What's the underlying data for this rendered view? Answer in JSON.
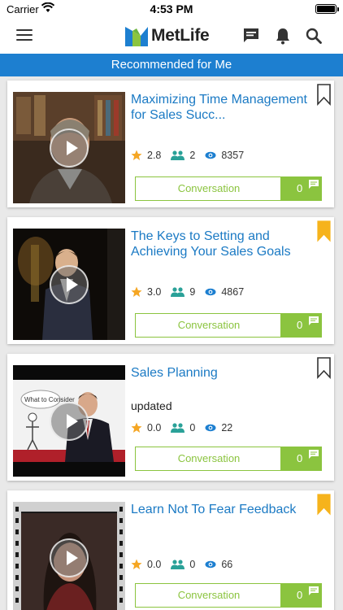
{
  "status_bar": {
    "carrier": "Carrier",
    "time": "4:53 PM"
  },
  "header": {
    "brand": "MetLife",
    "brand_color": "#1d7fd0"
  },
  "section": {
    "title": "Recommended for Me"
  },
  "colors": {
    "title_blue": "#1b7ac4",
    "accent_green": "#8bc43f",
    "bookmark_gold": "#f6b31c",
    "star": "#f5a623",
    "people": "#2aa198"
  },
  "cards": [
    {
      "title": "Maximizing Time Management for Sales Succ...",
      "subtitle": "",
      "rating": "2.8",
      "participants": "2",
      "views": "8357",
      "conversation_label": "Conversation",
      "conversation_count": "0",
      "bookmarked": false,
      "thumbnail": "man-in-library"
    },
    {
      "title": "The Keys to Setting and Achieving Your Sales Goals",
      "subtitle": "",
      "rating": "3.0",
      "participants": "9",
      "views": "4867",
      "conversation_label": "Conversation",
      "conversation_count": "0",
      "bookmarked": true,
      "thumbnail": "man-on-stage"
    },
    {
      "title": "Sales Planning",
      "subtitle": "updated",
      "rating": "0.0",
      "participants": "0",
      "views": "22",
      "conversation_label": "Conversation",
      "conversation_count": "0",
      "bookmarked": false,
      "thumbnail": "presenter-whiteboard",
      "thumbnail_caption": "What to Consider"
    },
    {
      "title": "Learn Not To Fear Feedback",
      "subtitle": "",
      "rating": "0.0",
      "participants": "0",
      "views": "66",
      "conversation_label": "Conversation",
      "conversation_count": "0",
      "bookmarked": true,
      "thumbnail": "woman-filmstrip"
    }
  ]
}
